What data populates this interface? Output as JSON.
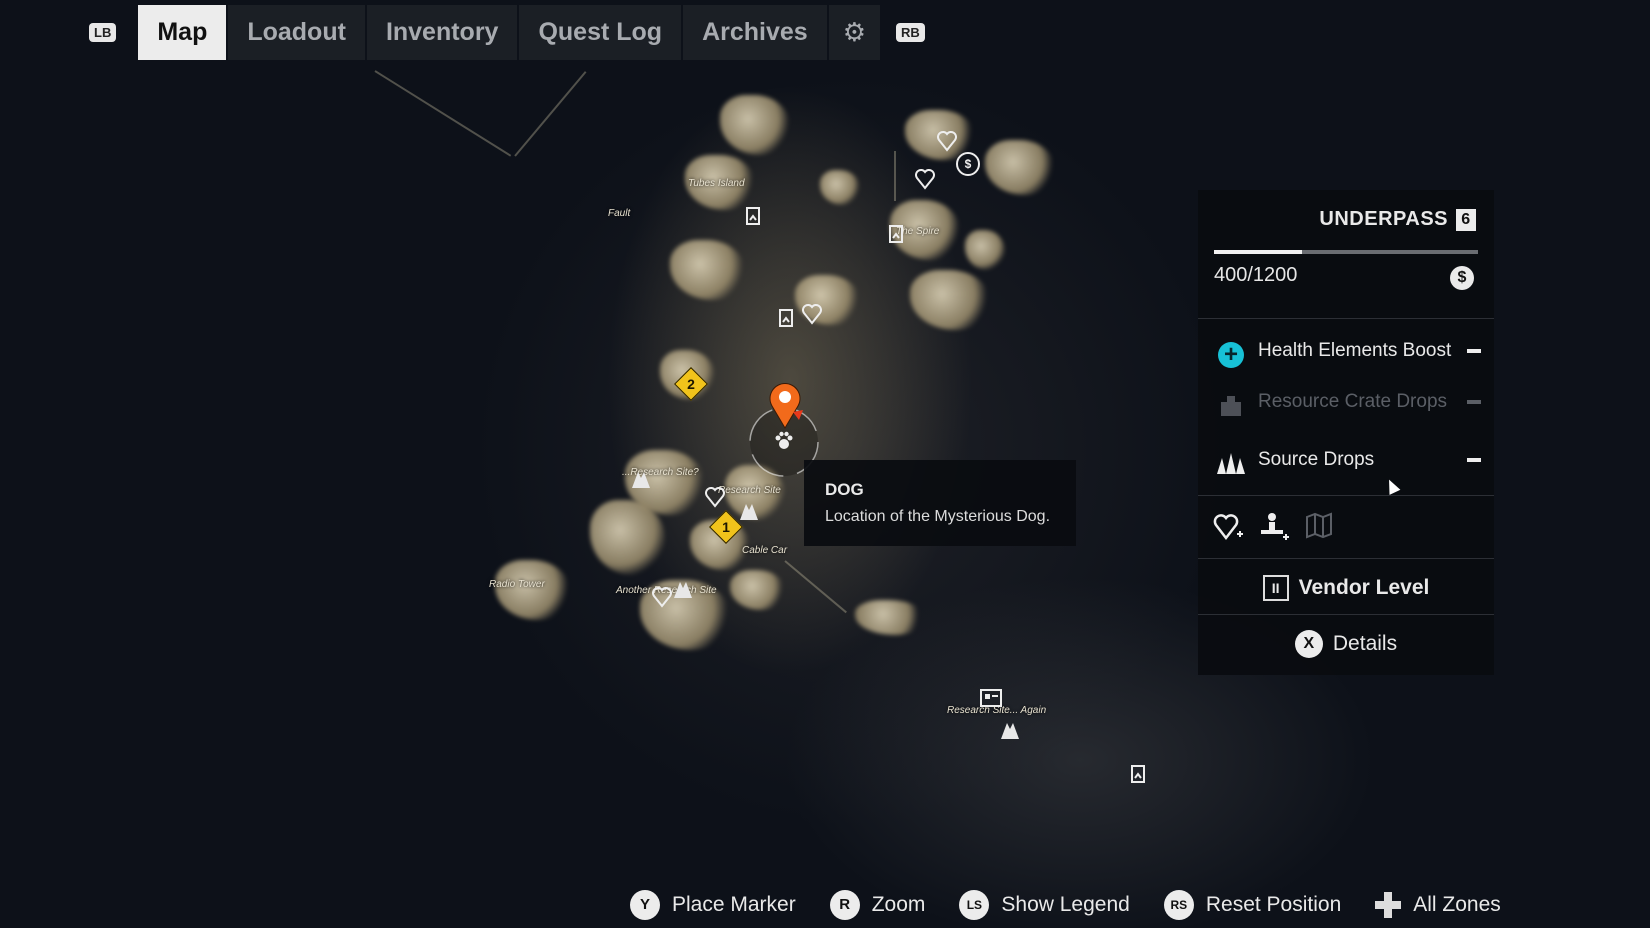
{
  "tabs": {
    "left_bumper": "LB",
    "right_bumper": "RB",
    "items": [
      {
        "label": "Map",
        "active": true
      },
      {
        "label": "Loadout",
        "active": false
      },
      {
        "label": "Inventory",
        "active": false
      },
      {
        "label": "Quest Log",
        "active": false
      },
      {
        "label": "Archives",
        "active": false
      }
    ],
    "settings_icon": "gear-icon"
  },
  "map": {
    "place_labels": {
      "tubes_island": "Tubes Island",
      "fault": "Fault",
      "spire": "The Spire",
      "research_site_q": "...Research Site?",
      "research_site": "Research Site",
      "cable_car": "Cable Car",
      "radio_tower": "Radio Tower",
      "another_research": "Another Research Site",
      "research_again": "Research Site... Again"
    },
    "markers": {
      "quest_1": "1",
      "quest_2": "2",
      "vendor_symbol": "$",
      "selected_icon": "paw-icon"
    }
  },
  "tooltip": {
    "title": "DOG",
    "description": "Location of the Mysterious Dog."
  },
  "zone_panel": {
    "name": "UNDERPASS",
    "level": "6",
    "progress_text": "400/1200",
    "progress_fraction": 0.333,
    "currency_icon": "coin-icon",
    "bonuses": [
      {
        "label": "Health Elements Boost",
        "icon": "health-plus-icon",
        "active": true
      },
      {
        "label": "Resource Crate Drops",
        "icon": "crate-icon",
        "active": false
      },
      {
        "label": "Source Drops",
        "icon": "source-crystal-icon",
        "active": true
      }
    ],
    "vendor_level_label": "Vendor Level",
    "vendor_level_value": "II",
    "details_button": "X",
    "details_label": "Details"
  },
  "hints": [
    {
      "button": "Y",
      "label": "Place Marker"
    },
    {
      "button": "R",
      "label": "Zoom"
    },
    {
      "button": "LS",
      "label": "Show Legend"
    },
    {
      "button": "RS",
      "label": "Reset Position"
    },
    {
      "button": "dpad",
      "label": "All Zones"
    }
  ],
  "colors": {
    "accent_cyan": "#17c1d6",
    "quest_yellow": "#f1c31b",
    "pin_orange": "#f26a1b"
  }
}
